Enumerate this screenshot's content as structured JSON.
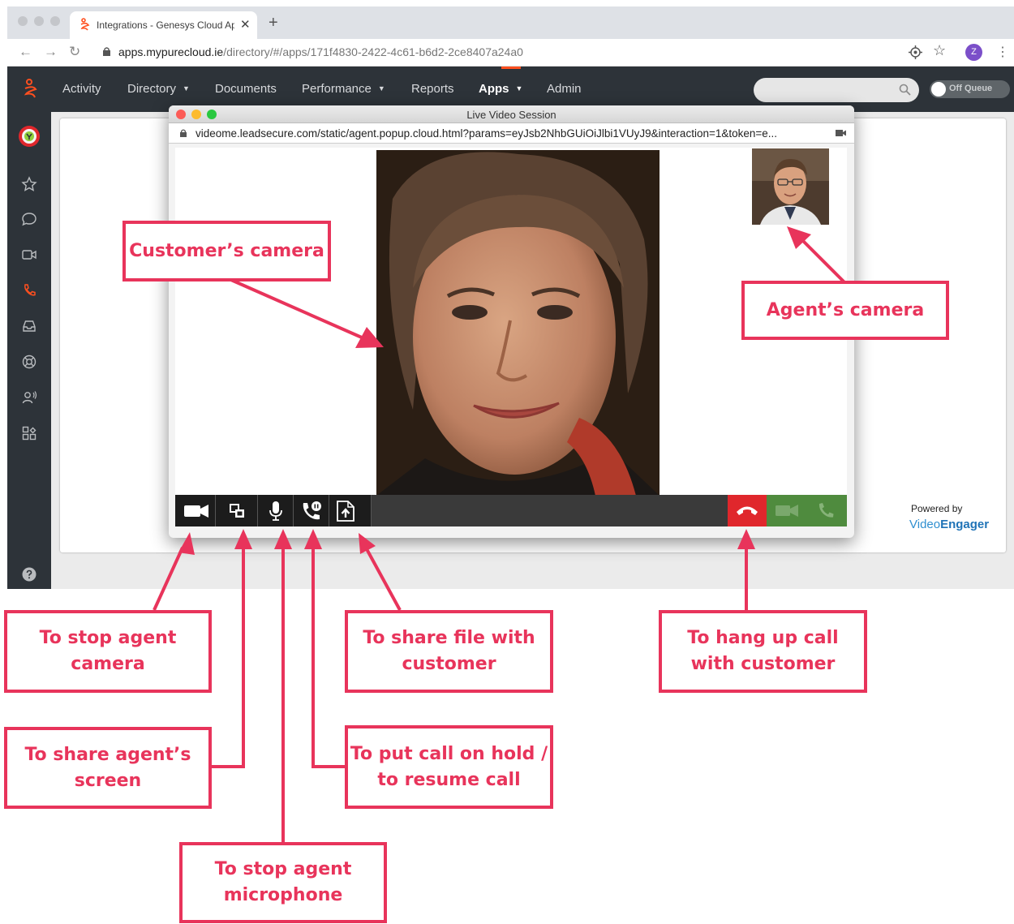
{
  "browser": {
    "tab_title": "Integrations - Genesys Cloud App",
    "tab_close": "✕",
    "new_tab": "+",
    "url_host": "apps.mypurecloud.ie",
    "url_path": "/directory/#/apps/171f4830-2422-4c61-b6d2-2ce8407a24a0",
    "profile_initial": "Z",
    "icons": [
      "back-icon",
      "forward-icon",
      "reload-icon",
      "lock-icon",
      "location-target-icon",
      "star-icon",
      "menu-icon"
    ]
  },
  "app": {
    "nav": {
      "activity": "Activity",
      "directory": "Directory",
      "documents": "Documents",
      "performance": "Performance",
      "reports": "Reports",
      "apps": "Apps",
      "admin": "Admin"
    },
    "queue_status": "Off Queue",
    "accent_color": "#ff4f1f",
    "sidebar_icons": [
      "favorites-icon",
      "chat-icon",
      "video-icon",
      "phone-icon",
      "inbox-icon",
      "support-icon",
      "contacts-icon",
      "apps-grid-icon",
      "help-icon"
    ],
    "powered_by": "Powered by",
    "brand_part1": "Video",
    "brand_part2": "Engager"
  },
  "popup": {
    "title": "Live Video Session",
    "url_host": "videome.leadsecure.com",
    "url_path": "/static/agent.popup.cloud.html?params=eyJsb2NhbGUiOiJlbi1VUyJ9&interaction=1&token=e...",
    "controls": [
      "camera-icon",
      "screen-share-icon",
      "microphone-icon",
      "hold-call-icon",
      "file-share-icon",
      "hangup-icon",
      "video-call-icon",
      "audio-call-icon"
    ]
  },
  "annotations": {
    "color": "#e8345b",
    "customer_camera": "Customer’s camera",
    "agent_camera": "Agent’s camera",
    "stop_camera": "To stop agent\ncamera",
    "share_screen": "To share agent’s\nscreen",
    "stop_microphone": "To stop agent\nmicrophone",
    "share_file": "To share file with\ncustomer",
    "hold_call": "To put call on hold /\nto resume call",
    "hang_up": "To hang up call\nwith customer"
  }
}
